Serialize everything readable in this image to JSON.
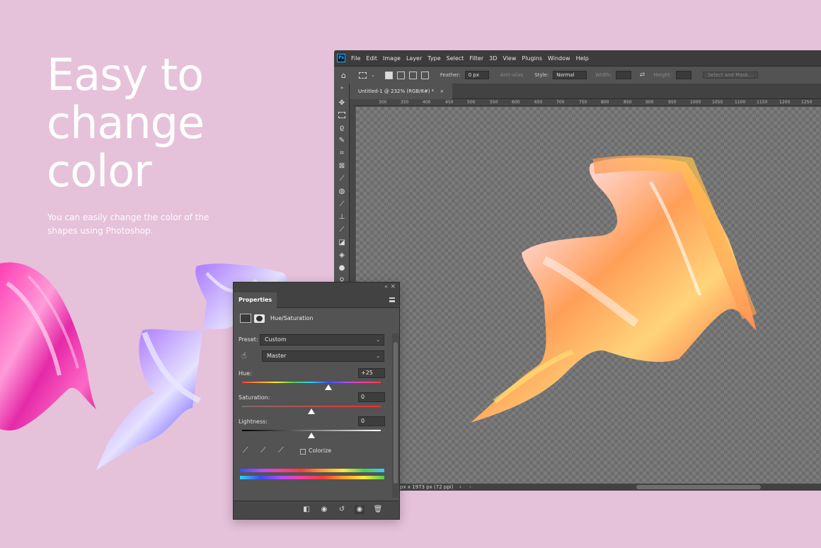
{
  "hero": {
    "title": "Easy to\nchange\ncolor",
    "subtitle": "You can easily change the color of the shapes using Photoshop."
  },
  "photoshop": {
    "logo": "Ps",
    "menu": [
      "File",
      "Edit",
      "Image",
      "Layer",
      "Type",
      "Select",
      "Filter",
      "3D",
      "View",
      "Plugins",
      "Window",
      "Help"
    ],
    "options": {
      "feather_label": "Feather:",
      "feather_value": "0 px",
      "anti_alias": "Anti-alias",
      "style_label": "Style:",
      "style_value": "Normal",
      "width_label": "Width:",
      "height_label": "Height:",
      "select_mask": "Select and Mask..."
    },
    "document_tab": "Untitled-1 @ 232% (RGB/8#) *",
    "ruler_ticks": [
      "300",
      "350",
      "400",
      "450",
      "500",
      "550",
      "600",
      "650",
      "700",
      "750",
      "800",
      "850",
      "900",
      "950",
      "1000",
      "1050",
      "1100",
      "1150",
      "1200",
      "1250"
    ],
    "status": "px x 1973 px (72 ppi)"
  },
  "properties": {
    "title": "Properties",
    "adjustment": "Hue/Saturation",
    "preset_label": "Preset:",
    "preset_value": "Custom",
    "channel_value": "Master",
    "hue_label": "Hue:",
    "hue_value": "+25",
    "saturation_label": "Saturation:",
    "saturation_value": "0",
    "lightness_label": "Lightness:",
    "lightness_value": "0",
    "colorize_label": "Colorize"
  },
  "icons": {
    "tools": [
      "move-icon",
      "marquee-icon",
      "lasso-icon",
      "quick-select-icon",
      "crop-icon",
      "frame-icon",
      "eyedropper-icon",
      "healing-icon",
      "brush-icon",
      "stamp-icon",
      "history-brush-icon",
      "eraser-icon",
      "paint-bucket-icon",
      "blur-icon",
      "dodge-icon"
    ]
  },
  "colors": {
    "background": "#e6c1da",
    "ps_panel": "#535353",
    "ps_dark": "#3c3c3c"
  }
}
